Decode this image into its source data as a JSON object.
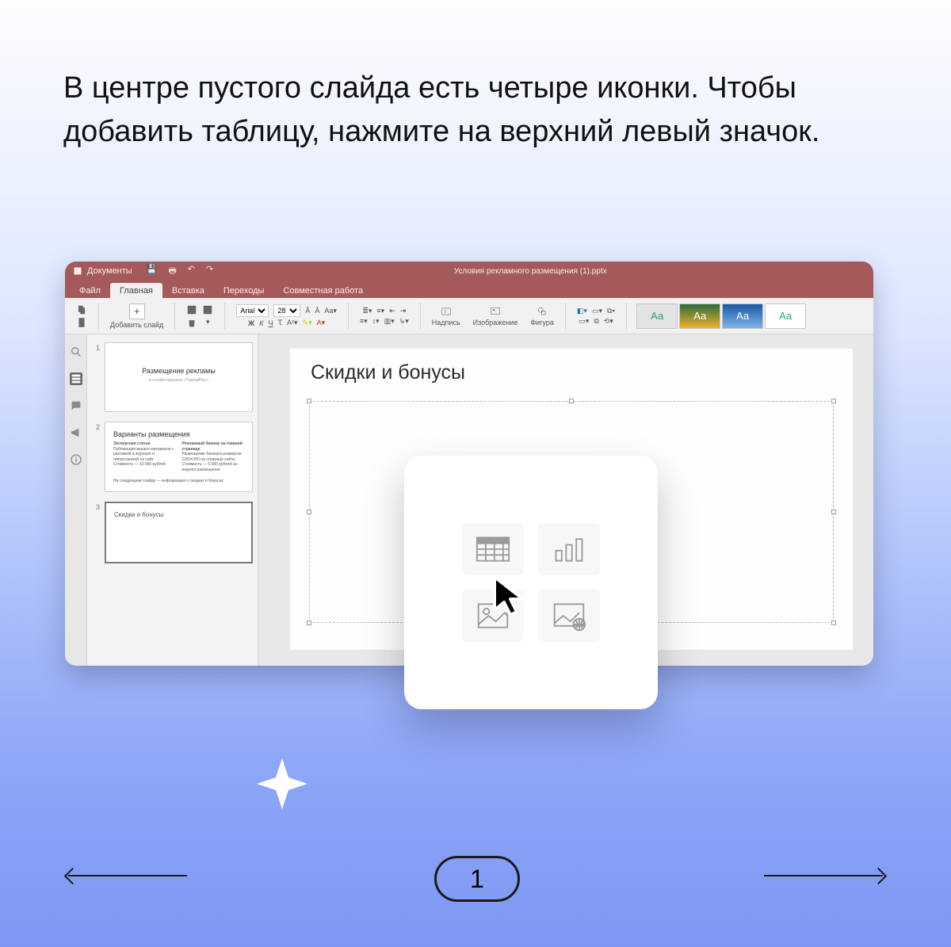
{
  "instruction": "В центре пустого слайда есть четыре иконки. Чтобы добавить таблицу, нажмите на верхний левый значок.",
  "app": {
    "brand": "Документы",
    "doc_name": "Условия рекламного размещения (1).pptx",
    "menus": {
      "file": "Файл",
      "home": "Главная",
      "insert": "Вставка",
      "transitions": "Переходы",
      "collab": "Совместная работа"
    }
  },
  "ribbon": {
    "add_slide": "Добавить слайд",
    "font_name": "Arial",
    "font_size": "28",
    "bold": "Ж",
    "italic": "К",
    "underline": "Ч",
    "strike": "Ꚍ",
    "textbox": "Надпись",
    "image": "Изображение",
    "shape": "Фигура",
    "theme_sample": "Аа"
  },
  "thumbnails": [
    {
      "num": "1",
      "title": "Размещение рекламы",
      "subtitle": "в онлайн-журнале «ТуризмПро»"
    },
    {
      "num": "2",
      "title": "Варианты размещения",
      "col1_h": "Экспертная статья",
      "col1_b": "Публикация вашего материала с рекламой в журнале и гиперссылкой на сайт",
      "col1_p": "Стоимость — 10 000 рублей",
      "col2_h": "Рекламный баннер на главной странице",
      "col2_b": "Размещение баннера размером 1350×200 на странице сайта",
      "col2_p": "Стоимость — 5 000 рублей за неделю размещения",
      "note": "На следующем слайде — информация о скидках и бонусах"
    },
    {
      "num": "3",
      "title": "Скидки и бонусы"
    }
  ],
  "slide": {
    "title": "Скидки и бонусы"
  },
  "popup": {
    "table": "insert-table",
    "chart": "insert-chart",
    "image": "insert-image",
    "online_image": "insert-online-image"
  },
  "pager": {
    "current": "1"
  }
}
